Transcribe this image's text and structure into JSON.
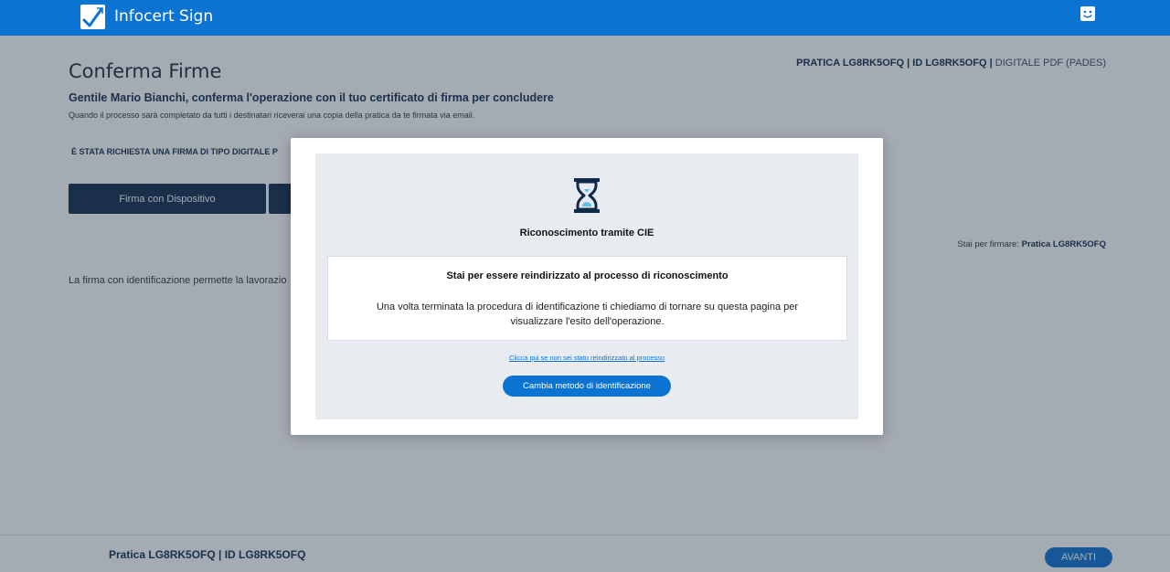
{
  "header": {
    "brand": "Infocert Sign",
    "logo_icon": "signature-check-icon",
    "support_icon": "chat-support-icon"
  },
  "page": {
    "title": "Conferma Firme",
    "pratica_info": {
      "pratica": "PRATICA LG8RK5OFQ",
      "separator": "|",
      "id": "ID LG8RK5OFQ",
      "format": "DIGITALE PDF (PADES)"
    },
    "greeting": "Gentile Mario Bianchi, conferma l'operazione con il tuo certificato di firma per concludere",
    "sub_greeting": "Quando il processo sarà completato da tutti i destinatari riceverai una copia della pratica da te firmata via email.",
    "requested": "È STATA RICHIESTA UNA FIRMA DI TIPO DIGITALE P",
    "device_button": "Firma con Dispositivo",
    "signing_for_label": "Stai per firmare:",
    "signing_for_value": "Pratica LG8RK5OFQ",
    "description": "La firma con identificazione permette la lavorazio"
  },
  "footer": {
    "pratica": "Pratica LG8RK5OFQ | ID LG8RK5OFQ",
    "next_button": "AVANTI"
  },
  "modal": {
    "icon": "hourglass-icon",
    "title": "Riconoscimento tramite CIE",
    "card_title": "Stai per essere reindirizzato al processo di riconoscimento",
    "card_text": "Una volta terminata la procedura di identificazione ti chiediamo di tornare su questa pagina per visualizzare l'esito dell'operazione.",
    "redirect_link": "Clicca qui se non sei stato reindirizzato al processo",
    "change_button": "Cambia metodo di identificazione"
  },
  "colors": {
    "primary": "#0b73d1",
    "dark_navy": "#0f2a4a",
    "modal_panel": "#e8ecf1"
  }
}
